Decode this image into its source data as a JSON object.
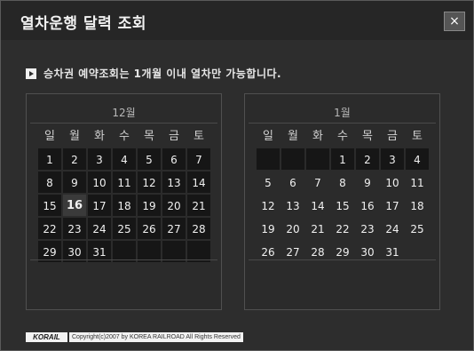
{
  "window": {
    "title": "열차운행 달력 조회",
    "close_label": "×"
  },
  "notice": {
    "text": "승차권 예약조회는 1개월 이내 열차만 가능합니다."
  },
  "weekdays": [
    "일",
    "월",
    "화",
    "수",
    "목",
    "금",
    "토"
  ],
  "calendar_left": {
    "month": "12월",
    "today": "16",
    "rows": [
      [
        "1",
        "2",
        "3",
        "4",
        "5",
        "6",
        "7"
      ],
      [
        "8",
        "9",
        "10",
        "11",
        "12",
        "13",
        "14"
      ],
      [
        "15",
        "16",
        "17",
        "18",
        "19",
        "20",
        "21"
      ],
      [
        "22",
        "23",
        "24",
        "25",
        "26",
        "27",
        "28"
      ],
      [
        "29",
        "30",
        "31",
        "",
        "",
        "",
        ""
      ]
    ]
  },
  "calendar_right": {
    "month": "1월",
    "rows": [
      [
        "",
        "",
        "",
        "1",
        "2",
        "3",
        "4"
      ],
      [
        "5",
        "6",
        "7",
        "8",
        "9",
        "10",
        "11"
      ],
      [
        "12",
        "13",
        "14",
        "15",
        "16",
        "17",
        "18"
      ],
      [
        "19",
        "20",
        "21",
        "22",
        "23",
        "24",
        "25"
      ],
      [
        "26",
        "27",
        "28",
        "29",
        "30",
        "31",
        ""
      ]
    ]
  },
  "footer": {
    "logo_text": "KORAIL",
    "copyright": "Copyright(c)2007 by KOREA RAILROAD All Rights Reserved"
  }
}
